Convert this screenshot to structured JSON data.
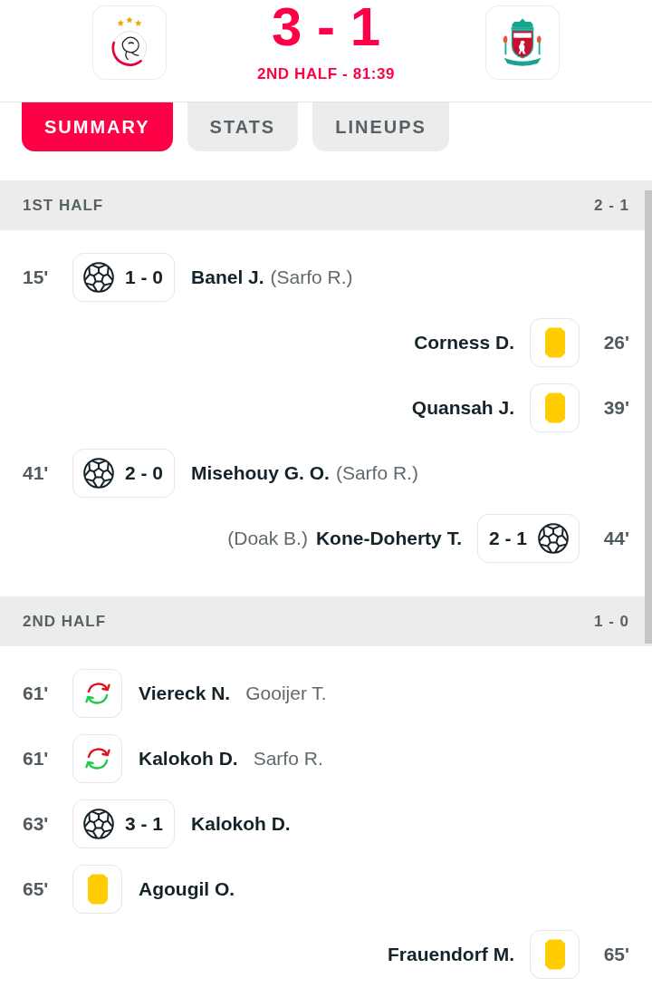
{
  "match": {
    "score": "3 - 1",
    "status": "2ND HALF - 81:39"
  },
  "tabs": [
    {
      "label": "SUMMARY",
      "selected": true
    },
    {
      "label": "STATS",
      "selected": false
    },
    {
      "label": "LINEUPS",
      "selected": false
    }
  ],
  "sections": [
    {
      "title": "1ST HALF",
      "score": "2 - 1",
      "events": [
        {
          "away": false,
          "time": "15'",
          "kind": "goal",
          "score": "1 - 0",
          "player": "Banel J.",
          "assist": "(Sarfo R.)"
        },
        {
          "away": true,
          "time": "26'",
          "kind": "yellow_card",
          "player": "Corness D."
        },
        {
          "away": true,
          "time": "39'",
          "kind": "yellow_card",
          "player": "Quansah J."
        },
        {
          "away": false,
          "time": "41'",
          "kind": "goal",
          "score": "2 - 0",
          "player": "Misehouy G. O.",
          "assist": "(Sarfo R.)"
        },
        {
          "away": true,
          "time": "44'",
          "kind": "goal",
          "score": "2 - 1",
          "player": "Kone-Doherty T.",
          "assist": "(Doak B.)"
        }
      ]
    },
    {
      "title": "2ND HALF",
      "score": "1 - 0",
      "events": [
        {
          "away": false,
          "time": "61'",
          "kind": "substitution",
          "player": "Viereck N.",
          "player_off": "Gooijer T."
        },
        {
          "away": false,
          "time": "61'",
          "kind": "substitution",
          "player": "Kalokoh D.",
          "player_off": "Sarfo R."
        },
        {
          "away": false,
          "time": "63'",
          "kind": "goal",
          "score": "3 - 1",
          "player": "Kalokoh D."
        },
        {
          "away": false,
          "time": "65'",
          "kind": "yellow_card",
          "player": "Agougil O."
        },
        {
          "away": true,
          "time": "65'",
          "kind": "yellow_card",
          "player": "Frauendorf M."
        }
      ]
    }
  ]
}
